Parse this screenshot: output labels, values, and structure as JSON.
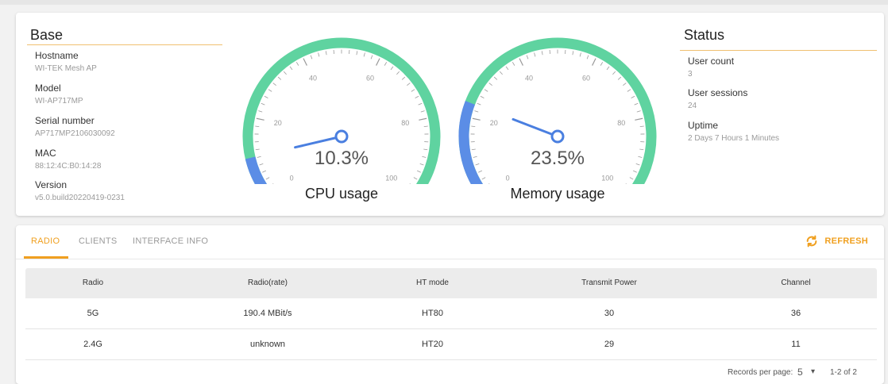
{
  "base": {
    "title": "Base",
    "hostname_label": "Hostname",
    "hostname_value": "WI-TEK Mesh AP",
    "model_label": "Model",
    "model_value": "WI-AP717MP",
    "serial_label": "Serial number",
    "serial_value": "AP717MP2106030092",
    "mac_label": "MAC",
    "mac_value": "88:12:4C:B0:14:28",
    "version_label": "Version",
    "version_value": "v5.0.build20220419-0231"
  },
  "gauges": {
    "ticks": [
      "0",
      "20",
      "40",
      "60",
      "80",
      "100"
    ],
    "cpu": {
      "percent": 10.3,
      "percent_text": "10.3%",
      "caption": "CPU usage"
    },
    "memory": {
      "percent": 23.5,
      "percent_text": "23.5%",
      "caption": "Memory usage"
    },
    "colors": {
      "track": "#5fd3a0",
      "used": "#5b8de6",
      "needle": "#4a7fe0"
    }
  },
  "status": {
    "title": "Status",
    "user_count_label": "User count",
    "user_count_value": "3",
    "user_sessions_label": "User sessions",
    "user_sessions_value": "24",
    "uptime_label": "Uptime",
    "uptime_value": "2 Days 7 Hours 1 Minutes"
  },
  "tabs": {
    "items": [
      "RADIO",
      "CLIENTS",
      "INTERFACE INFO"
    ],
    "active": "RADIO",
    "refresh_label": "REFRESH",
    "accent": "#f0a020"
  },
  "table": {
    "headers": [
      "Radio",
      "Radio(rate)",
      "HT mode",
      "Transmit Power",
      "Channel"
    ],
    "rows": [
      [
        "5G",
        "190.4 MBit/s",
        "HT80",
        "30",
        "36"
      ],
      [
        "2.4G",
        "unknown",
        "HT20",
        "29",
        "11"
      ]
    ]
  },
  "pager": {
    "records_label": "Records per page:",
    "records_value": "5",
    "range": "1-2 of 2"
  }
}
